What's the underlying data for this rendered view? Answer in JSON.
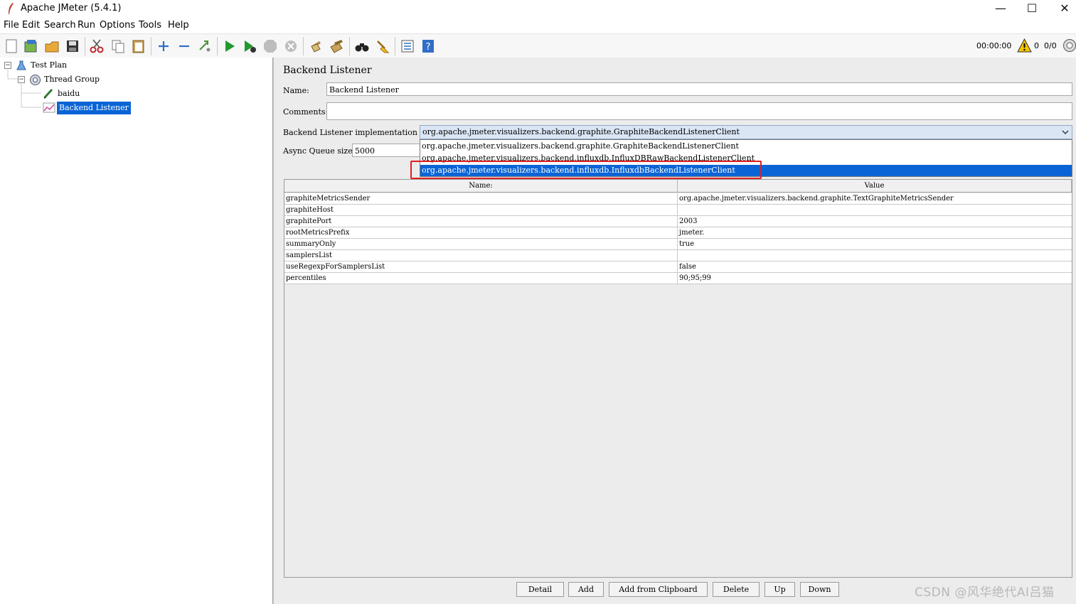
{
  "window": {
    "title": "Apache JMeter (5.4.1)",
    "controls": [
      "—",
      "☐",
      "✕"
    ]
  },
  "menu": [
    "File",
    "Edit",
    "Search",
    "Run",
    "Options",
    "Tools",
    "Help"
  ],
  "toolbar": {
    "icons": [
      "new-icon",
      "templates-icon",
      "open-icon",
      "save-icon",
      "cut-icon",
      "copy-icon",
      "paste-icon",
      "expand-icon",
      "collapse-icon",
      "toggle-icon",
      "start-icon",
      "start-no-pause-icon",
      "stop-icon",
      "shutdown-icon",
      "clear-icon",
      "clear-all-icon",
      "search-icon",
      "reset-search-icon",
      "function-helper-icon",
      "help-icon"
    ],
    "timer": "00:00:00",
    "warning_count": "0",
    "threads": "0/0"
  },
  "tree": {
    "items": [
      {
        "label": "Test Plan",
        "icon": "test-plan-icon"
      },
      {
        "label": "Thread Group",
        "icon": "thread-group-icon"
      },
      {
        "label": "baidu",
        "icon": "sampler-icon"
      },
      {
        "label": "Backend Listener",
        "icon": "listener-icon",
        "selected": true
      }
    ]
  },
  "panel": {
    "title": "Backend Listener",
    "name_label": "Name:",
    "name_value": "Backend Listener",
    "comments_label": "Comments:",
    "comments_value": "",
    "impl_label": "Backend Listener implementation",
    "impl_selected": "org.apache.jmeter.visualizers.backend.graphite.GraphiteBackendListenerClient",
    "impl_options": [
      "org.apache.jmeter.visualizers.backend.graphite.GraphiteBackendListenerClient",
      "org.apache.jmeter.visualizers.backend.influxdb.InfluxDBRawBackendListenerClient",
      "org.apache.jmeter.visualizers.backend.influxdb.InfluxdbBackendListenerClient"
    ],
    "queue_label": "Async Queue size",
    "queue_value": "5000"
  },
  "table": {
    "headers": [
      "Name:",
      "Value"
    ],
    "rows": [
      [
        "graphiteMetricsSender",
        "org.apache.jmeter.visualizers.backend.graphite.TextGraphiteMetricsSender"
      ],
      [
        "graphiteHost",
        ""
      ],
      [
        "graphitePort",
        "2003"
      ],
      [
        "rootMetricsPrefix",
        "jmeter."
      ],
      [
        "summaryOnly",
        "true"
      ],
      [
        "samplersList",
        ""
      ],
      [
        "useRegexpForSamplersList",
        "false"
      ],
      [
        "percentiles",
        "90;95;99"
      ]
    ]
  },
  "buttons": [
    "Detail",
    "Add",
    "Add from Clipboard",
    "Delete",
    "Up",
    "Down"
  ],
  "watermark": "CSDN @风华绝代AI吕猫",
  "colors": {
    "selection": "#0a64d6",
    "highlight_box": "#e02020"
  }
}
